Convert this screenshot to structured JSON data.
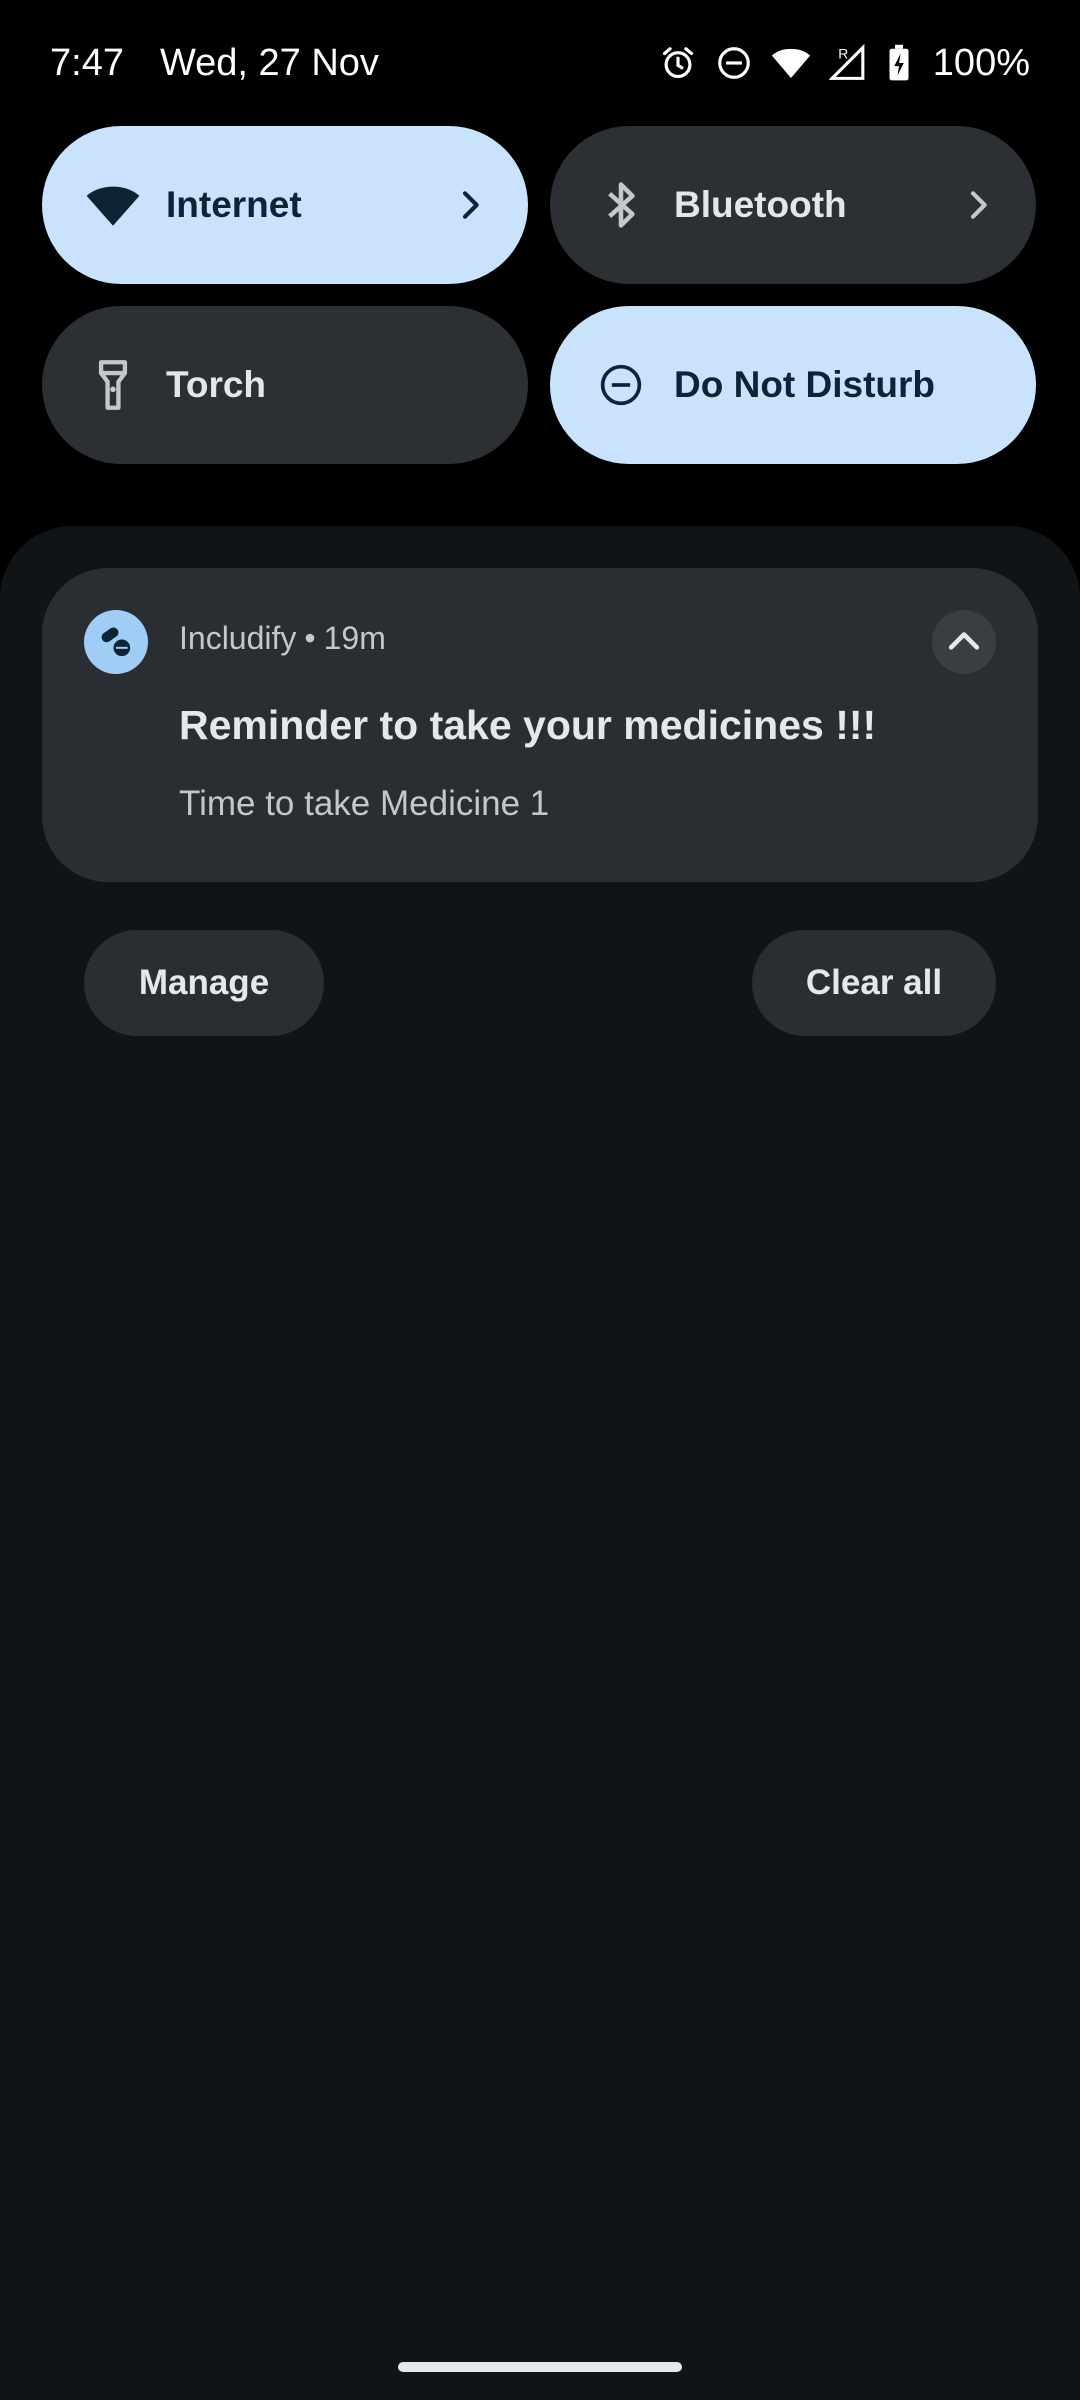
{
  "status_bar": {
    "time": "7:47",
    "date": "Wed, 27 Nov",
    "battery": "100%",
    "icons": [
      "alarm-icon",
      "dnd-icon",
      "wifi-icon",
      "signal-roaming-icon",
      "battery-charging-icon"
    ]
  },
  "tiles": [
    {
      "label": "Internet",
      "state": "on",
      "icon": "wifi-icon",
      "has_chevron": true
    },
    {
      "label": "Bluetooth",
      "state": "off",
      "icon": "bluetooth-icon",
      "has_chevron": true
    },
    {
      "label": "Torch",
      "state": "off",
      "icon": "torch-icon",
      "has_chevron": false
    },
    {
      "label": "Do Not Disturb",
      "state": "on",
      "icon": "dnd-icon",
      "has_chevron": false
    }
  ],
  "notification": {
    "app_name": "Includify",
    "separator": "•",
    "time_ago": "19m",
    "title": "Reminder to take your medicines !!!",
    "text": "Time to take Medicine 1",
    "app_icon": "pills-icon"
  },
  "actions": {
    "manage_label": "Manage",
    "clear_all_label": "Clear all"
  },
  "colors": {
    "tile_on": "#c8e3fb",
    "tile_off": "#2c2f33",
    "shade_bg": "#111417",
    "card_bg": "#2a2d31"
  }
}
